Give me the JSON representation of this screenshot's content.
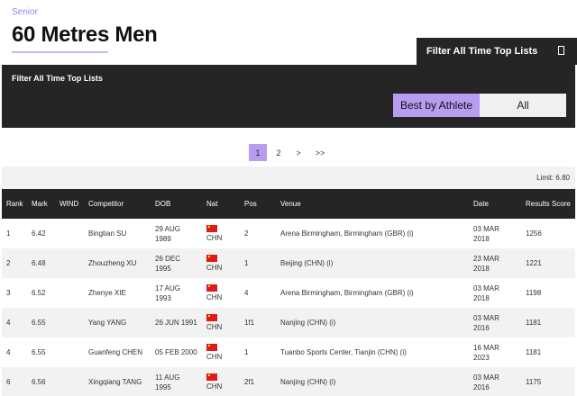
{
  "header": {
    "category": "Senior",
    "title": "60 Metres Men"
  },
  "filter": {
    "tab_label": "Filter All Time Top Lists",
    "panel_title": "Filter All Time Top Lists",
    "toggle": {
      "best_by_athlete": "Best by Athlete",
      "all": "All",
      "selected": "Best by Athlete"
    }
  },
  "pagination": {
    "pages": [
      "1",
      "2"
    ],
    "current": "1",
    "next": ">",
    "last": ">>"
  },
  "limit": "Limit: 6.80",
  "table": {
    "columns": {
      "rank": "Rank",
      "mark": "Mark",
      "wind": "WIND",
      "competitor": "Competitor",
      "dob": "DOB",
      "nat": "Nat",
      "pos": "Pos",
      "venue": "Venue",
      "date": "Date",
      "results_score": "Results Score"
    },
    "rows": [
      {
        "rank": "1",
        "mark": "6.42",
        "wind": "",
        "competitor": "Bingtian SU",
        "dob": "29 AUG 1989",
        "nat": "CHN",
        "pos": "2",
        "venue": "Arena Birmingham, Birmingham (GBR) (i)",
        "date": "03 MAR 2018",
        "score": "1256"
      },
      {
        "rank": "2",
        "mark": "6.48",
        "wind": "",
        "competitor": "Zhouzheng XU",
        "dob": "26 DEC 1995",
        "nat": "CHN",
        "pos": "1",
        "venue": "Beijing (CHN) (i)",
        "date": "23 MAR 2018",
        "score": "1221"
      },
      {
        "rank": "3",
        "mark": "6.52",
        "wind": "",
        "competitor": "Zhenye XIE",
        "dob": "17 AUG 1993",
        "nat": "CHN",
        "pos": "4",
        "venue": "Arena Birmingham, Birmingham (GBR) (i)",
        "date": "03 MAR 2018",
        "score": "1198"
      },
      {
        "rank": "4",
        "mark": "6.55",
        "wind": "",
        "competitor": "Yang YANG",
        "dob": "26 JUN 1991",
        "nat": "CHN",
        "pos": "1f1",
        "venue": "Nanjing (CHN) (i)",
        "date": "03 MAR 2016",
        "score": "1181"
      },
      {
        "rank": "4",
        "mark": "6.55",
        "wind": "",
        "competitor": "Guanfeng CHEN",
        "dob": "05 FEB 2000",
        "nat": "CHN",
        "pos": "1",
        "venue": "Tuanbo Sports Center, Tianjin (CHN) (i)",
        "date": "16 MAR 2023",
        "score": "1181"
      },
      {
        "rank": "6",
        "mark": "6.56",
        "wind": "",
        "competitor": "Xingqiang TANG",
        "dob": "11 AUG 1995",
        "nat": "CHN",
        "pos": "2f1",
        "venue": "Nanjing (CHN) (i)",
        "date": "03 MAR 2016",
        "score": "1175"
      }
    ]
  },
  "colors": {
    "accent": "#b79cf0",
    "dark_panel": "#252525",
    "row_alt": "#f2f2f2"
  }
}
